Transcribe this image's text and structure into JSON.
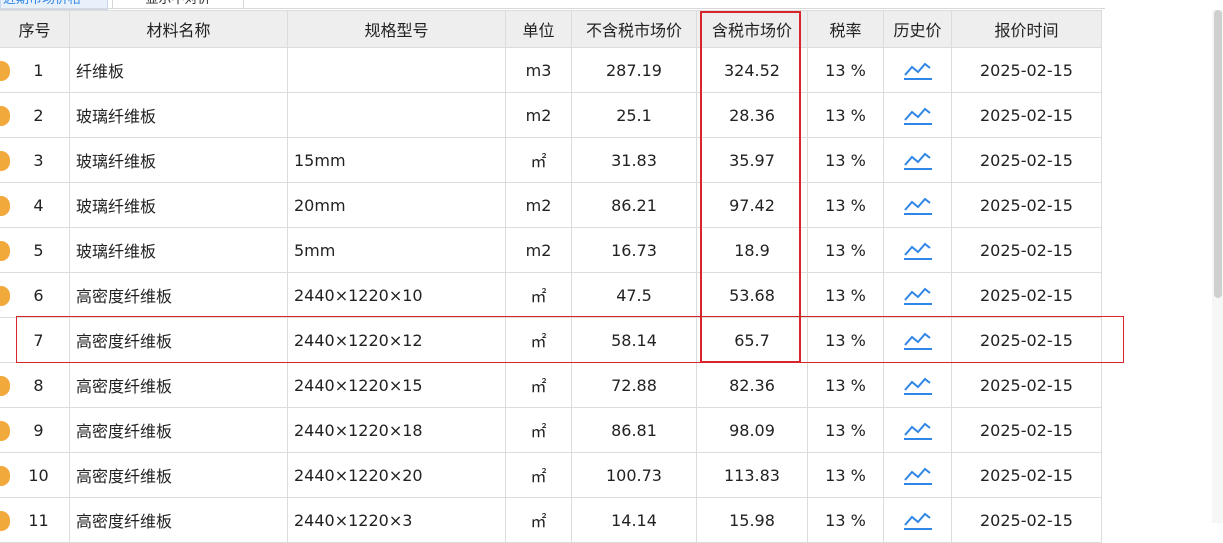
{
  "tabs": [
    {
      "label": "近期市场价格"
    },
    {
      "label": "显示不对价"
    }
  ],
  "table": {
    "headers": [
      "序号",
      "材料名称",
      "规格型号",
      "单位",
      "不含税市场价",
      "含税市场价",
      "税率",
      "历史价",
      "报价时间"
    ],
    "rows": [
      {
        "seq": "1",
        "name": "纤维板",
        "spec": "",
        "unit": "m3",
        "price_ex": "287.19",
        "price_in": "324.52",
        "tax": "13 %",
        "date": "2025-02-15",
        "marker": true
      },
      {
        "seq": "2",
        "name": "玻璃纤维板",
        "spec": "",
        "unit": "m2",
        "price_ex": "25.1",
        "price_in": "28.36",
        "tax": "13 %",
        "date": "2025-02-15",
        "marker": true
      },
      {
        "seq": "3",
        "name": "玻璃纤维板",
        "spec": "15mm",
        "unit": "㎡",
        "price_ex": "31.83",
        "price_in": "35.97",
        "tax": "13 %",
        "date": "2025-02-15",
        "marker": true
      },
      {
        "seq": "4",
        "name": "玻璃纤维板",
        "spec": "20mm",
        "unit": "m2",
        "price_ex": "86.21",
        "price_in": "97.42",
        "tax": "13 %",
        "date": "2025-02-15",
        "marker": true
      },
      {
        "seq": "5",
        "name": "玻璃纤维板",
        "spec": "5mm",
        "unit": "m2",
        "price_ex": "16.73",
        "price_in": "18.9",
        "tax": "13 %",
        "date": "2025-02-15",
        "marker": true
      },
      {
        "seq": "6",
        "name": "高密度纤维板",
        "spec": "2440×1220×10",
        "unit": "㎡",
        "price_ex": "47.5",
        "price_in": "53.68",
        "tax": "13 %",
        "date": "2025-02-15",
        "marker": true
      },
      {
        "seq": "7",
        "name": "高密度纤维板",
        "spec": "2440×1220×12",
        "unit": "㎡",
        "price_ex": "58.14",
        "price_in": "65.7",
        "tax": "13 %",
        "date": "2025-02-15",
        "marker": false
      },
      {
        "seq": "8",
        "name": "高密度纤维板",
        "spec": "2440×1220×15",
        "unit": "㎡",
        "price_ex": "72.88",
        "price_in": "82.36",
        "tax": "13 %",
        "date": "2025-02-15",
        "marker": true
      },
      {
        "seq": "9",
        "name": "高密度纤维板",
        "spec": "2440×1220×18",
        "unit": "㎡",
        "price_ex": "86.81",
        "price_in": "98.09",
        "tax": "13 %",
        "date": "2025-02-15",
        "marker": true
      },
      {
        "seq": "10",
        "name": "高密度纤维板",
        "spec": "2440×1220×20",
        "unit": "㎡",
        "price_ex": "100.73",
        "price_in": "113.83",
        "tax": "13 %",
        "date": "2025-02-15",
        "marker": true
      },
      {
        "seq": "11",
        "name": "高密度纤维板",
        "spec": "2440×1220×3",
        "unit": "㎡",
        "price_ex": "14.14",
        "price_in": "15.98",
        "tax": "13 %",
        "date": "2025-02-15",
        "marker": true
      }
    ]
  },
  "icons": {
    "history": "trend-chart-icon",
    "row_marker": "orange-marker-icon"
  },
  "colors": {
    "accent": "#2f86e6",
    "highlight": "#d6262b",
    "marker": "#f2a93b",
    "header_bg": "#eeeeee"
  }
}
